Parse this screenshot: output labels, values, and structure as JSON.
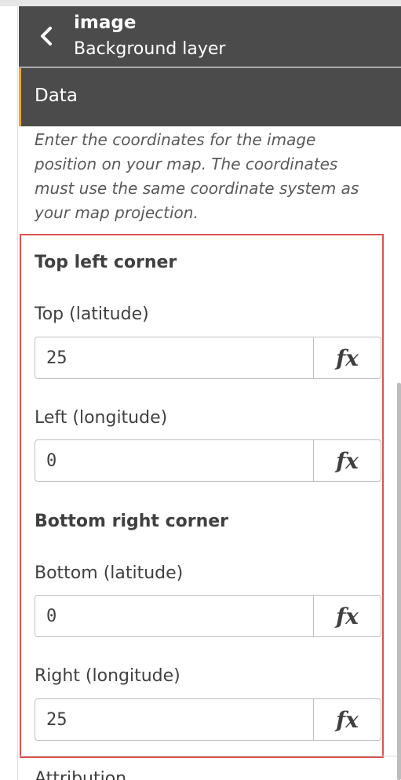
{
  "header": {
    "title": "image",
    "subtitle": "Background layer"
  },
  "section": {
    "label": "Data"
  },
  "description": "Enter the coordinates for the image position on your map. The coordinates must use the same coordinate system as your map projection.",
  "top_left": {
    "title": "Top left corner",
    "top_label": "Top (latitude)",
    "top_value": "25",
    "left_label": "Left (longitude)",
    "left_value": "0"
  },
  "bottom_right": {
    "title": "Bottom right corner",
    "bottom_label": "Bottom (latitude)",
    "bottom_value": "0",
    "right_label": "Right (longitude)",
    "right_value": "25"
  },
  "fx_label": "fx",
  "attribution_label": "Attribution",
  "colors": {
    "header_bg": "#4b4b4b",
    "accent": "#f5a623",
    "highlight": "#d9534f"
  },
  "icons": {
    "back": "chevron-left-icon",
    "expression": "fx-icon"
  }
}
